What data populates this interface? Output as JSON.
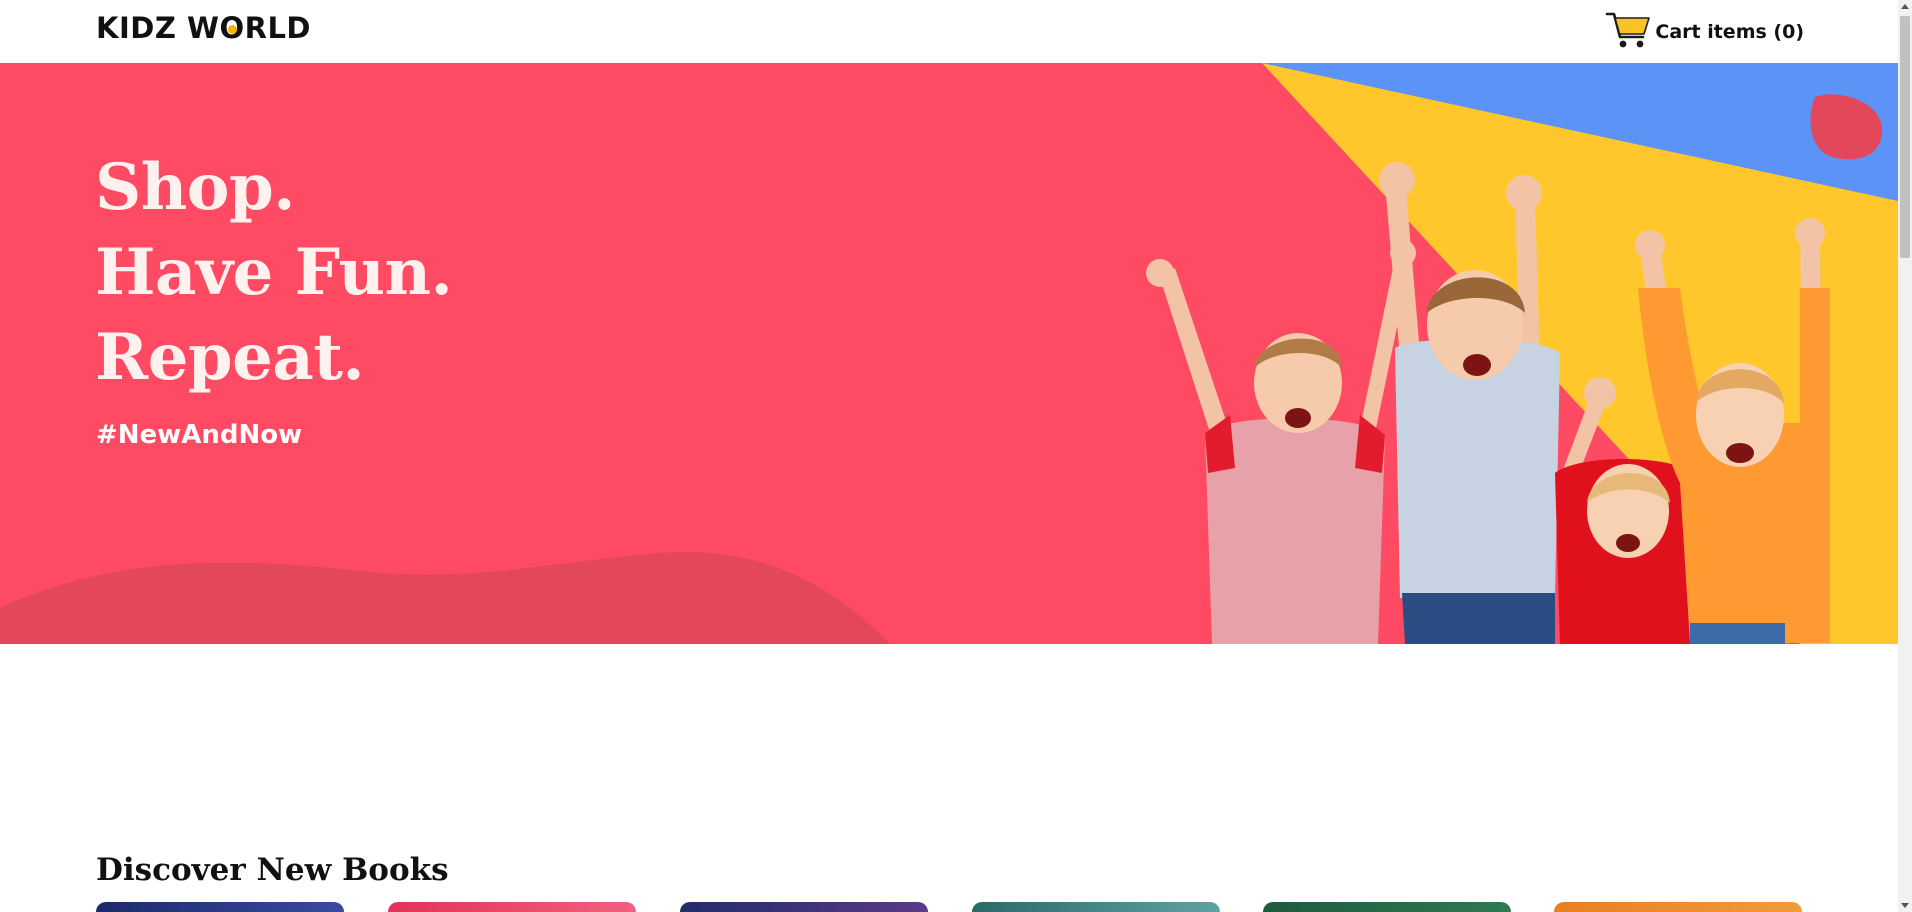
{
  "header": {
    "logo_text_1": "KIDZ W",
    "logo_text_o": "O",
    "logo_text_2": "RLD",
    "cart_label": "Cart items (0)",
    "cart_icon": "shopping-cart-icon"
  },
  "hero": {
    "line_1": "Shop.",
    "line_2": "Have Fun.",
    "line_3": "Repeat.",
    "hashtag": "#NewAndNow",
    "image": "kids-cheering-image"
  },
  "books_section": {
    "title": "Discover New Books"
  },
  "colors": {
    "hero_background": "#ff4a63",
    "hero_wave": "#e2475c",
    "stripe_yellow": "#ffc72c",
    "stripe_blue": "#5b93f7",
    "logo_accent": "#f5b400",
    "cart_icon": "#f7c325"
  }
}
